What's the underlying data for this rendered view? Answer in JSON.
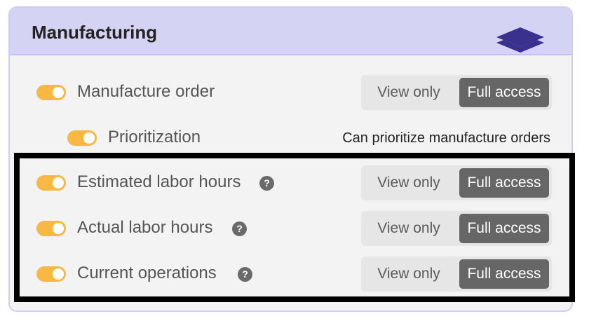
{
  "section": {
    "title": "Manufacturing",
    "icon": "layers-icon"
  },
  "permissions": [
    {
      "label": "Manufacture order",
      "enabled": true,
      "view_label": "View only",
      "full_label": "Full access",
      "selected": "Full access"
    },
    {
      "label": "Prioritization",
      "enabled": true,
      "description": "Can prioritize manufacture orders"
    },
    {
      "label": "Estimated labor hours",
      "enabled": true,
      "help": "?",
      "view_label": "View only",
      "full_label": "Full access",
      "selected": "Full access"
    },
    {
      "label": "Actual labor hours",
      "enabled": true,
      "help": "?",
      "view_label": "View only",
      "full_label": "Full access",
      "selected": "Full access"
    },
    {
      "label": "Current operations",
      "enabled": true,
      "help": "?",
      "view_label": "View only",
      "full_label": "Full access",
      "selected": "Full access"
    }
  ],
  "colors": {
    "header_bg": "#d5d3f3",
    "toggle_on": "#f7b944",
    "selected_segment": "#666666",
    "icon": "#3a318f"
  }
}
